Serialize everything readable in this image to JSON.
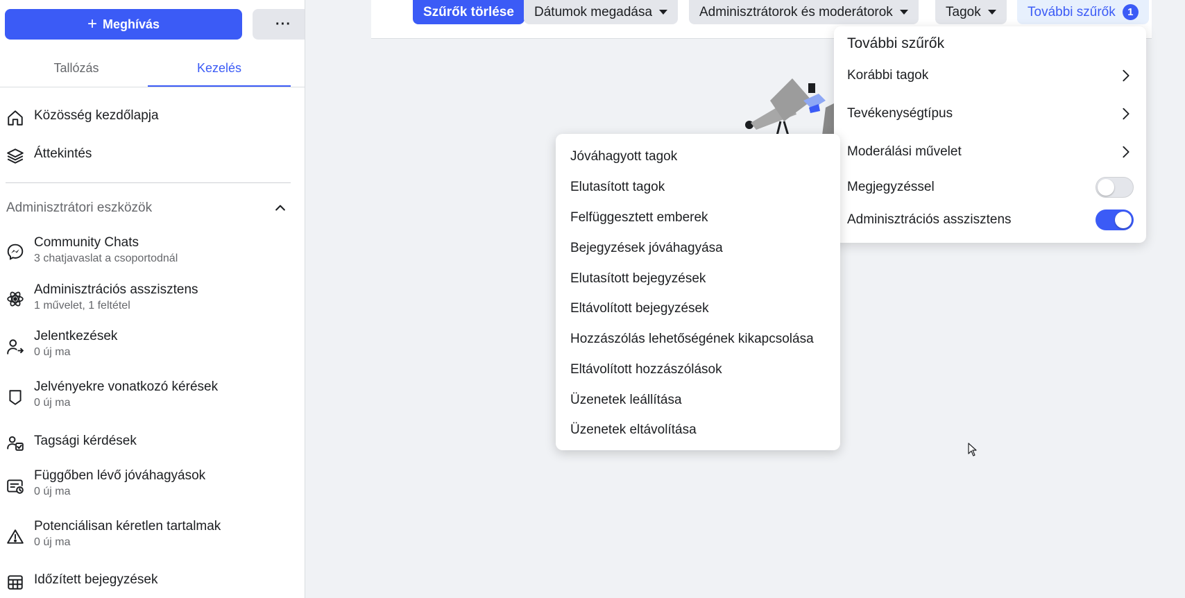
{
  "sidebar": {
    "invite_label": "Meghívás",
    "more_label": "···",
    "tabs": [
      {
        "label": "Tallózás"
      },
      {
        "label": "Kezelés"
      }
    ],
    "top_items": [
      {
        "label": "Közösség kezdőlapja",
        "icon": "home-icon"
      },
      {
        "label": "Áttekintés",
        "icon": "layers-icon"
      }
    ],
    "section_title": "Adminisztrátori eszközök",
    "items": [
      {
        "label": "Community Chats",
        "sub": "3 chatjavaslat a csoportodnál",
        "icon": "messenger-icon"
      },
      {
        "label": "Adminisztrációs asszisztens",
        "sub": "1 művelet, 1 feltétel",
        "icon": "atom-icon"
      },
      {
        "label": "Jelentkezések",
        "sub": "0 új ma",
        "icon": "person-arrow-icon"
      },
      {
        "label": "Jelvényekre vonatkozó kérések",
        "sub": "0 új ma",
        "icon": "badge-shield-icon"
      },
      {
        "label": "Tagsági kérdések",
        "sub": "",
        "icon": "person-check-icon"
      },
      {
        "label": "Függőben lévő jóváhagyások",
        "sub": "0 új ma",
        "icon": "clock-card-icon"
      },
      {
        "label": "Potenciálisan kéretlen tartalmak",
        "sub": "0 új ma",
        "icon": "warning-icon"
      },
      {
        "label": "Időzített bejegyzések",
        "sub": "",
        "icon": "calendar-grid-icon"
      }
    ]
  },
  "filters": {
    "clear_label": "Szűrők törlése",
    "dates_label": "Dátumok megadása",
    "admins_label": "Adminisztrátorok és moderátorok",
    "members_label": "Tagok",
    "more_label": "További szűrők",
    "more_count": "1"
  },
  "more_panel": {
    "title": "További szűrők",
    "rows": [
      {
        "label": "Korábbi tagok"
      },
      {
        "label": "Tevékenységtípus"
      },
      {
        "label": "Moderálási művelet"
      }
    ],
    "toggles": [
      {
        "label": "Megjegyzéssel",
        "on": false
      },
      {
        "label": "Adminisztrációs asszisztens",
        "on": true
      }
    ]
  },
  "activity_panel": {
    "items": [
      "Jóváhagyott tagok",
      "Elutasított tagok",
      "Felfüggesztett emberek",
      "Bejegyzések jóváhagyása",
      "Elutasított bejegyzések",
      "Eltávolított bejegyzések",
      "Hozzászólás lehetőségének kikapcsolása",
      "Eltávolított hozzászólások",
      "Üzenetek leállítása",
      "Üzenetek eltávolítása"
    ]
  },
  "colors": {
    "accent": "#3b5bf6",
    "chip_gray": "#e4e6eb",
    "background": "#f0f2f5"
  }
}
